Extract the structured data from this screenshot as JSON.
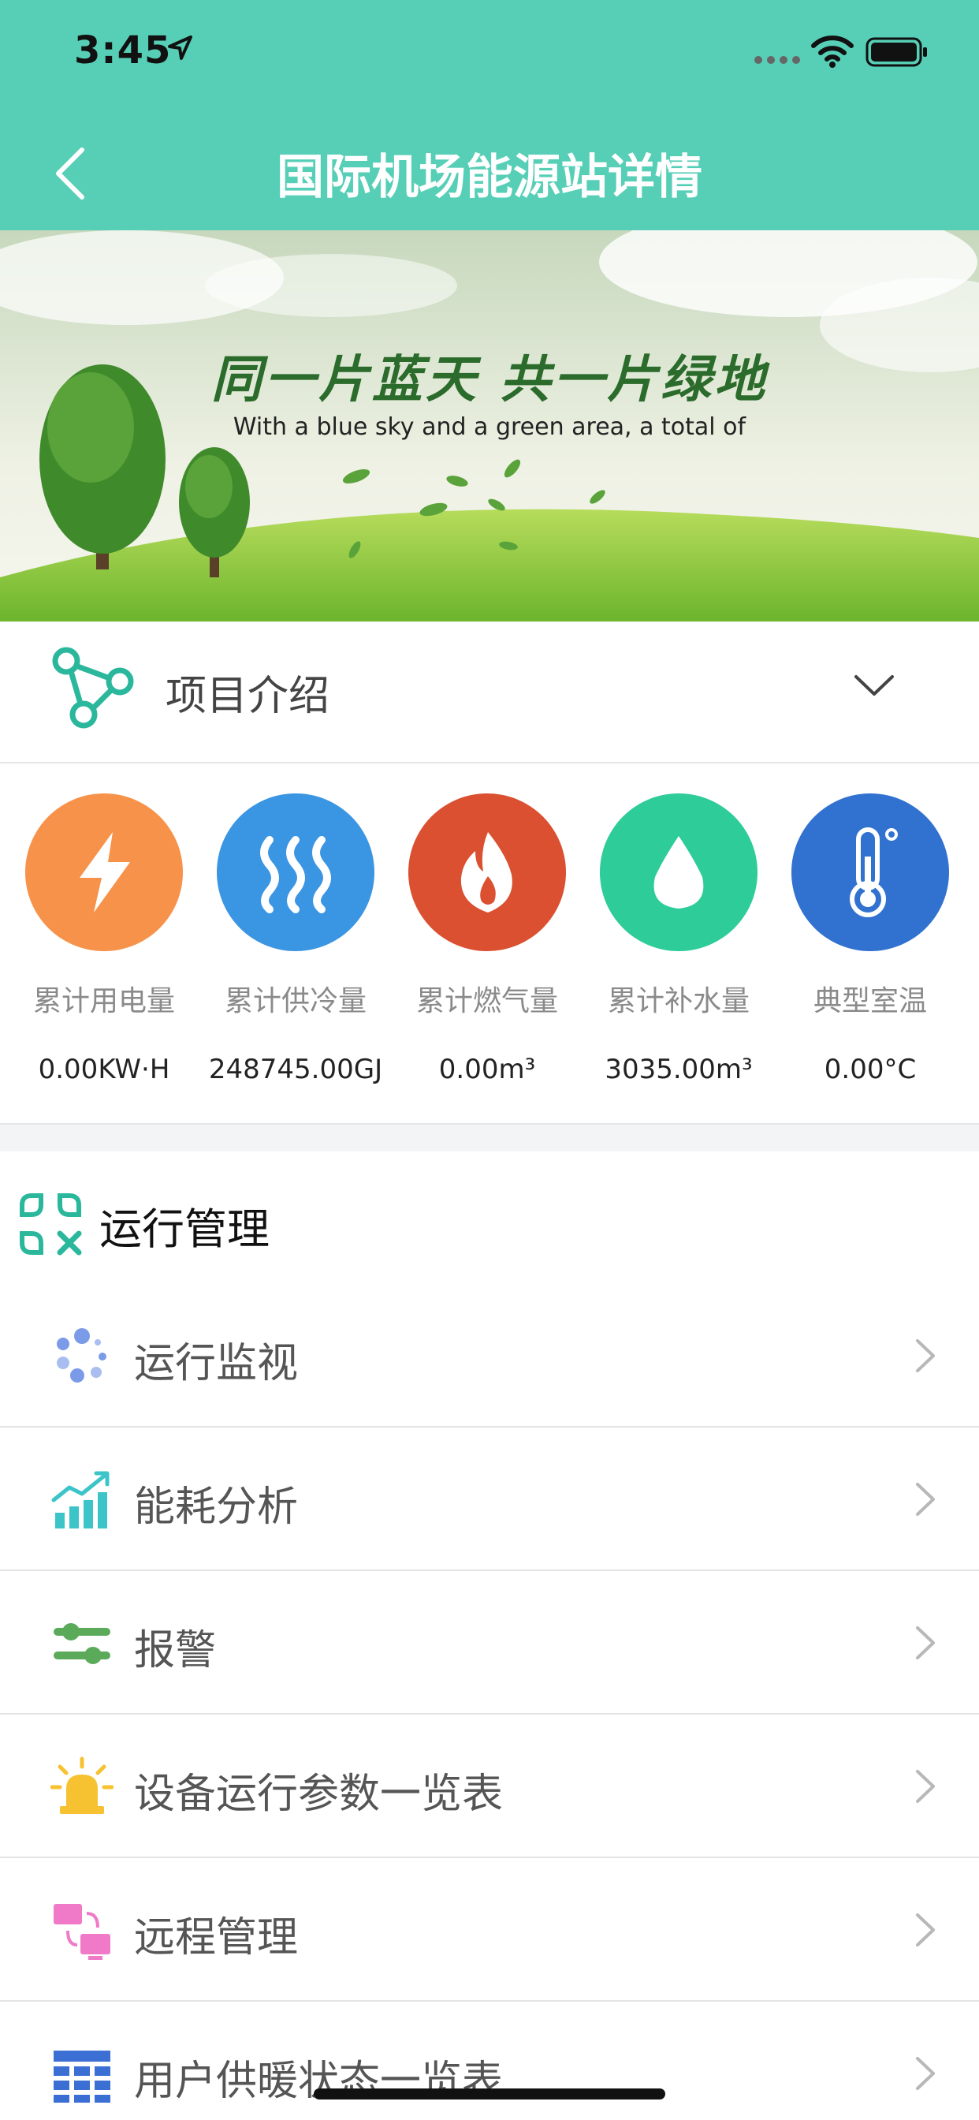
{
  "status_bar": {
    "time": "3:45"
  },
  "header": {
    "title": "国际机场能源站详情"
  },
  "banner": {
    "cn_text": "同一片蓝天 共一片绿地",
    "en_text": "With a blue sky and a green area, a total of"
  },
  "intro": {
    "label": "项目介绍"
  },
  "stats": [
    {
      "label": "累计用电量",
      "value": "0.00KW·H",
      "color": "#f7924a",
      "icon": "lightning-icon"
    },
    {
      "label": "累计供冷量",
      "value": "248745.00GJ",
      "color": "#3a95e2",
      "icon": "steam-icon"
    },
    {
      "label": "累计燃气量",
      "value": "0.00m³",
      "color": "#da5030",
      "icon": "flame-icon"
    },
    {
      "label": "累计补水量",
      "value": "3035.00m³",
      "color": "#2ecc99",
      "icon": "water-drop-icon"
    },
    {
      "label": "典型室温",
      "value": "0.00°C",
      "color": "#3172d0",
      "icon": "thermometer-icon"
    }
  ],
  "section": {
    "title": "运行管理"
  },
  "menu": [
    {
      "label": "运行监视",
      "icon": "monitor-dots-icon"
    },
    {
      "label": "能耗分析",
      "icon": "chart-trend-icon"
    },
    {
      "label": "报警",
      "icon": "alarm-sliders-icon"
    },
    {
      "label": "设备运行参数一览表",
      "icon": "alarm-light-icon"
    },
    {
      "label": "远程管理",
      "icon": "remote-manage-icon"
    },
    {
      "label": "用户供暖状态一览表",
      "icon": "grid-table-icon"
    }
  ]
}
